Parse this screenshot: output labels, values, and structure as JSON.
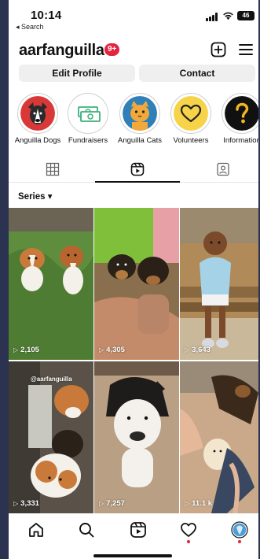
{
  "status_bar": {
    "time": "10:14",
    "back_label": "◂ Search",
    "battery": "46"
  },
  "header": {
    "username": "aarfanguilla",
    "notification_count": "9+",
    "new_post_icon": "plus-square-icon",
    "menu_icon": "hamburger-menu-icon"
  },
  "profile_actions": {
    "edit_profile": "Edit Profile",
    "contact": "Contact"
  },
  "highlights": [
    {
      "label": "Anguilla Dogs",
      "icon": "dog-photo"
    },
    {
      "label": "Fundraisers",
      "icon": "money-icon"
    },
    {
      "label": "Anguilla Cats",
      "icon": "cat-icon"
    },
    {
      "label": "Volunteers",
      "icon": "heart-icon"
    },
    {
      "label": "Information",
      "icon": "question-icon"
    }
  ],
  "tabs": [
    {
      "name": "grid",
      "icon": "grid-icon",
      "active": false
    },
    {
      "name": "reels",
      "icon": "reels-icon",
      "active": true
    },
    {
      "name": "tagged",
      "icon": "tagged-person-icon",
      "active": false
    }
  ],
  "series_label": "Series ▾",
  "reels": [
    {
      "views": "2,105",
      "watermark": ""
    },
    {
      "views": "4,305",
      "watermark": ""
    },
    {
      "views": "3,643",
      "watermark": ""
    },
    {
      "views": "3,331",
      "watermark": "@aarfanguilla"
    },
    {
      "views": "7,257",
      "watermark": ""
    },
    {
      "views": "11.1 k",
      "watermark": ""
    }
  ],
  "bottom_nav": [
    {
      "name": "home",
      "icon": "home-icon"
    },
    {
      "name": "search",
      "icon": "search-icon"
    },
    {
      "name": "reels",
      "icon": "reels-icon"
    },
    {
      "name": "activity",
      "icon": "heart-icon"
    },
    {
      "name": "profile",
      "icon": "avatar-icon"
    }
  ],
  "colors": {
    "accent_red": "#e2243f",
    "button_bg": "#efefef",
    "highlight_yellow": "#f7d34a"
  }
}
